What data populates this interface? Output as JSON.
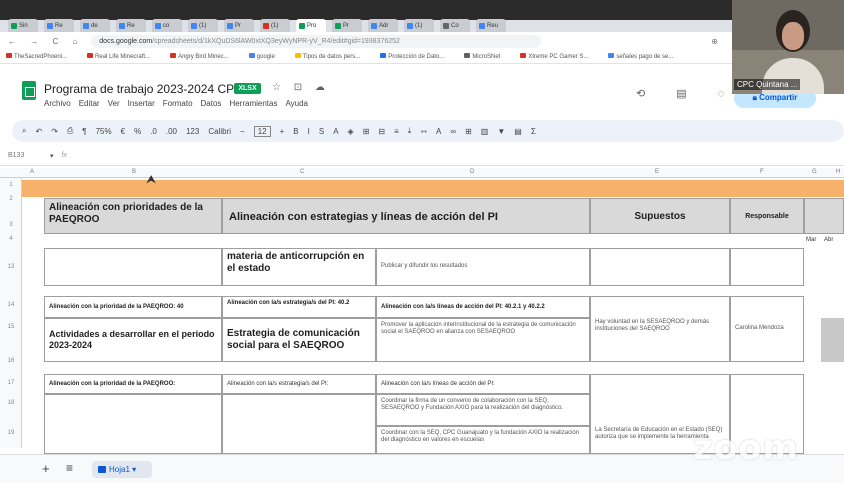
{
  "browser": {
    "tabs": [
      {
        "label": "Sin",
        "color": "#0f9d58"
      },
      {
        "label": "Re",
        "color": "#4285f4"
      },
      {
        "label": "de",
        "color": "#4285f4"
      },
      {
        "label": "Re",
        "color": "#4285f4"
      },
      {
        "label": "co",
        "color": "#4285f4"
      },
      {
        "label": "(1)",
        "color": "#4285f4"
      },
      {
        "label": "Pr",
        "color": "#4285f4"
      },
      {
        "label": "(1)",
        "color": "#d93025"
      },
      {
        "label": "Pro",
        "color": "#0f9d58"
      },
      {
        "label": "Pr",
        "color": "#0f9d58"
      },
      {
        "label": "Adr",
        "color": "#4285f4"
      },
      {
        "label": "(1)",
        "color": "#4285f4"
      },
      {
        "label": "Co",
        "color": "#666666"
      },
      {
        "label": "Reu",
        "color": "#4285f4"
      }
    ],
    "nav_icons": "← → C ⌂",
    "url_host": "docs.google.com",
    "url_path": "/spreadsheets/d/1kXQuDS6lAW0xtXQ3eyWyNPR-yV_R4/edit#gid=1938376252",
    "addr_icons": "⊕ ⇧ ☆ ■",
    "bookmarks": [
      "TheSacredPhoeni...",
      "Real Life Minecraft...",
      "Angry Bird Minec...",
      "google",
      "Tipos de datos pers...",
      "Protección de Dato...",
      "MicroSNet",
      "Xtreme PC Gamer S...",
      "señales pago de se..."
    ]
  },
  "doc": {
    "title": "Programa de trabajo 2023-2024 CPC",
    "badge": "XLSX",
    "title_icons": "☆ ⊡ ☁",
    "menu": [
      "Archivo",
      "Editar",
      "Ver",
      "Insertar",
      "Formato",
      "Datos",
      "Herramientas",
      "Ayuda"
    ],
    "header_icons": "⟲ ▤ ◌",
    "share_label": "Compartir"
  },
  "toolbar": {
    "items": [
      "⌕",
      "↶",
      "↷",
      "⎙",
      "¶"
    ],
    "zoom": "75%",
    "format_items": [
      "€",
      "%",
      ".0",
      ".00",
      "123"
    ],
    "font": "Calibri",
    "minus": "−",
    "font_size": "12",
    "plus": "+",
    "style_items": [
      "B",
      "I",
      "S",
      "A",
      "◈",
      "⊞",
      "⊟",
      "≡",
      "⤓",
      "⇿",
      "A",
      "∞",
      "⊞",
      "▥",
      "▼",
      "▤",
      "Σ"
    ]
  },
  "formula": {
    "cell_ref": "B133",
    "fx": "fx"
  },
  "grid": {
    "col_letters": [
      "A",
      "B",
      "C",
      "D",
      "E",
      "F",
      "G",
      "H"
    ],
    "row_numbers": [
      "1",
      "2",
      "3",
      "4",
      "13",
      "14",
      "15",
      "16",
      "17",
      "18",
      "19"
    ],
    "headers": {
      "h1": "Alineación con prioridades de la PAEQROO",
      "h2": "Alineación con estrategias y líneas de acción del PI",
      "h3": "Supuestos",
      "h4": "Responsable"
    },
    "months": [
      "Mar",
      "Abr"
    ],
    "row1": {
      "b": "materia de anticorrupción en el estado",
      "c": "Publicar y difundir los resultados"
    },
    "row2": {
      "a_top": "Alineación con la prioridad de la PAEQROO: 40",
      "b_top": "Alineación con la/s estrategia/s del PI: 40.2",
      "c_top": "Alineación con la/s líneas de acción del PI: 40.2.1 y 40.2.2",
      "a": "Actividades a desarrollar en el periodo 2023-2024",
      "b": "Estrategia de comunicación social para el SAEQROO",
      "c": "Promover la aplicación interinstitucional de la estrategia de comunicación social el SAEQROO en alianza con SESAEQROO",
      "d": "Hay voluntad en la SESAEQROO y demás instituciones del SAEQROO",
      "e": "Carolina Mendoza"
    },
    "row3": {
      "a_top": "Alineación con la prioridad de la PAEQROO:",
      "b_top": "Alineación con la/s estrategia/s del PI:",
      "c_top": "Alineación con la/s líneas de acción del PI:",
      "c1": "Coordinar la firma de un convenio de colaboración con la SEQ, SESAEQROO y Fundación AXIO para la realización del diagnóstico.",
      "c2": "Coordinar con la SEQ, CPC Guanajuato y la fundación AXIO la realización del diagnóstico en valores en escuelas",
      "d": "La Secretaría de Educación en el Estado (SEQ) autoriza que se implemente la herramienta"
    }
  },
  "sheetbar": {
    "plus": "+",
    "menu": "≡",
    "sheet_name": "Hoja1 ▾"
  },
  "zoom": {
    "participant_name": "CPC Quintana ...",
    "watermark": "zoom"
  }
}
